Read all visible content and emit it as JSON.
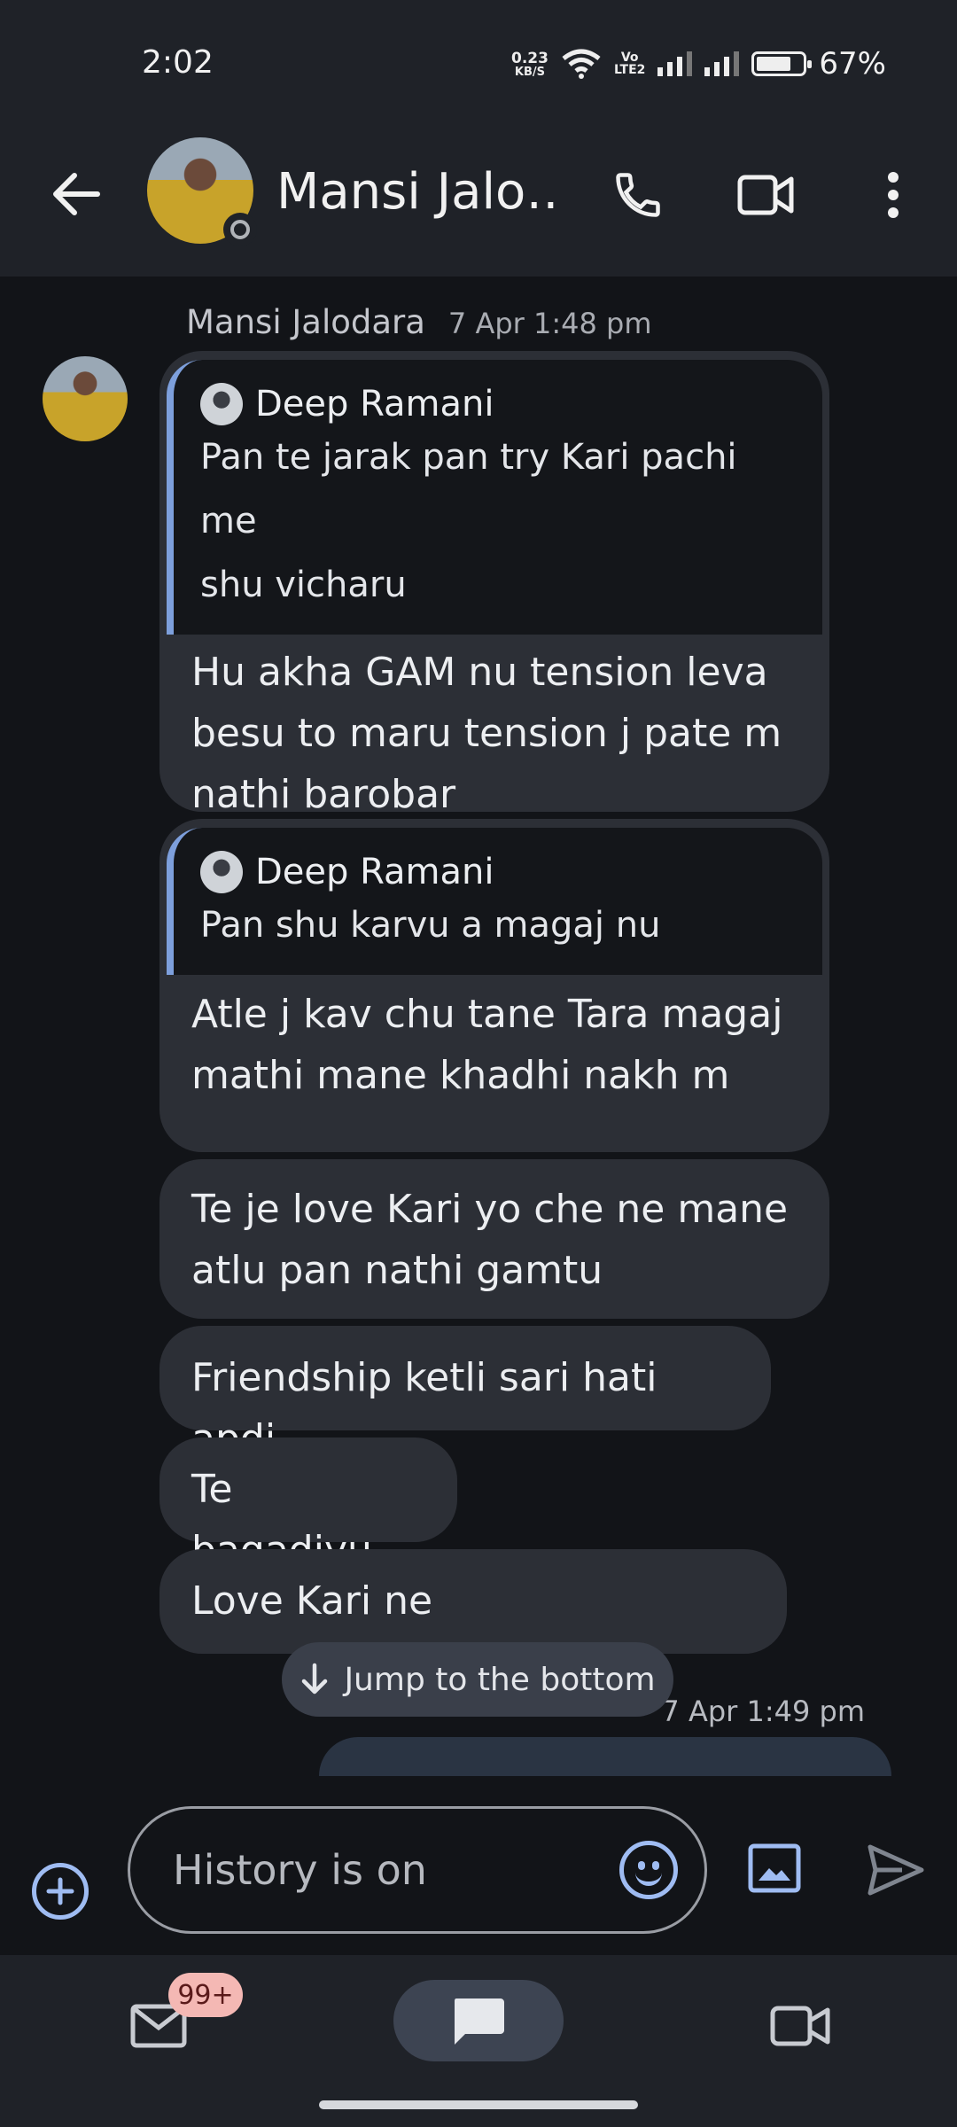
{
  "status_bar": {
    "time": "2:02",
    "net_speed_value": "0.23",
    "net_speed_unit": "KB/S",
    "volte_top": "Vo",
    "volte_bottom": "LTE2",
    "battery_percent": "67%"
  },
  "header": {
    "contact_name": "Mansi Jalo…",
    "icons": [
      "back-arrow-icon",
      "phone-icon",
      "video-camera-icon",
      "more-vert-icon"
    ]
  },
  "conversation": {
    "sender": "Mansi Jalodara",
    "sender_timestamp": "7 Apr 1:48 pm",
    "messages": [
      {
        "quote_author": "Deep Ramani",
        "quote_lines": [
          "Pan te jarak pan try Kari pachi me",
          "shu vicharu"
        ],
        "lines": [
          "Hu akha GAM nu tension leva",
          "besu to maru tension j pate m",
          "nathi barobar"
        ]
      },
      {
        "quote_author": "Deep Ramani",
        "quote_lines": [
          "Pan shu karvu a magaj nu"
        ],
        "lines": [
          "Atle j kav chu tane Tara magaj",
          "mathi mane khadhi nakh m"
        ]
      },
      {
        "lines": [
          "Te je love Kari yo che ne mane",
          "atlu pan nathi gamtu"
        ]
      },
      {
        "lines": [
          "Friendship ketli sari hati apdi"
        ]
      },
      {
        "lines": [
          "Te bagadiyu"
        ]
      },
      {
        "lines": [
          "Love Kari ne"
        ]
      }
    ],
    "jump_to_bottom": "Jump to the bottom",
    "outgoing_timestamp": "7 Apr 1:49 pm"
  },
  "composer": {
    "placeholder": "History is on",
    "icons": [
      "add-circle-icon",
      "emoji-icon",
      "image-icon",
      "send-icon"
    ]
  },
  "bottom_nav": {
    "mail_badge": "99+",
    "items": [
      "mail",
      "chat",
      "meet"
    ]
  },
  "colors": {
    "background": "#121418",
    "header": "#1f2228",
    "bubble": "#2c2f36",
    "accent": "#9fbcf2",
    "quote_bar": "#7d9fdc"
  }
}
